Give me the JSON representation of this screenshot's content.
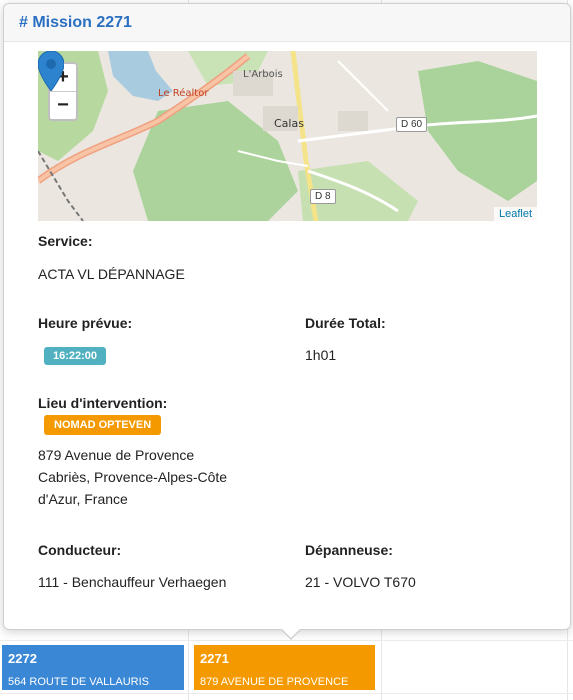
{
  "popover": {
    "title": "# Mission 2271",
    "map": {
      "zoom_in": "+",
      "zoom_out": "−",
      "attribution": "Leaflet",
      "labels": {
        "place_arbois": "L'Arbois",
        "place_realtor": "Le Réaltor",
        "place_calas": "Calas",
        "road_d60": "D 60",
        "road_d8": "D 8"
      },
      "marker_color": "#2e83cf"
    },
    "service": {
      "label": "Service:",
      "value": "ACTA VL DÉPANNAGE"
    },
    "heure_prevue": {
      "label": "Heure prévue:",
      "value": "16:22:00"
    },
    "duree_total": {
      "label": "Durée Total:",
      "value": "1h01"
    },
    "lieu": {
      "label": "Lieu d'intervention:",
      "badge": "NOMAD OPTEVEN",
      "address_line1": "879 Avenue de Provence",
      "address_line2": "Cabriès, Provence-Alpes-Côte",
      "address_line3": "d'Azur, France"
    },
    "conducteur": {
      "label": "Conducteur:",
      "value": "111 - Benchauffeur Verhaegen"
    },
    "depanneuse": {
      "label": "Dépanneuse:",
      "value": "21 - VOLVO T670"
    }
  },
  "events": [
    {
      "number": "2272",
      "address": "564 ROUTE DE VALLAURIS",
      "color": "#3a87d6"
    },
    {
      "number": "2271",
      "address": "879 AVENUE DE PROVENCE",
      "color": "#f49a00"
    }
  ]
}
